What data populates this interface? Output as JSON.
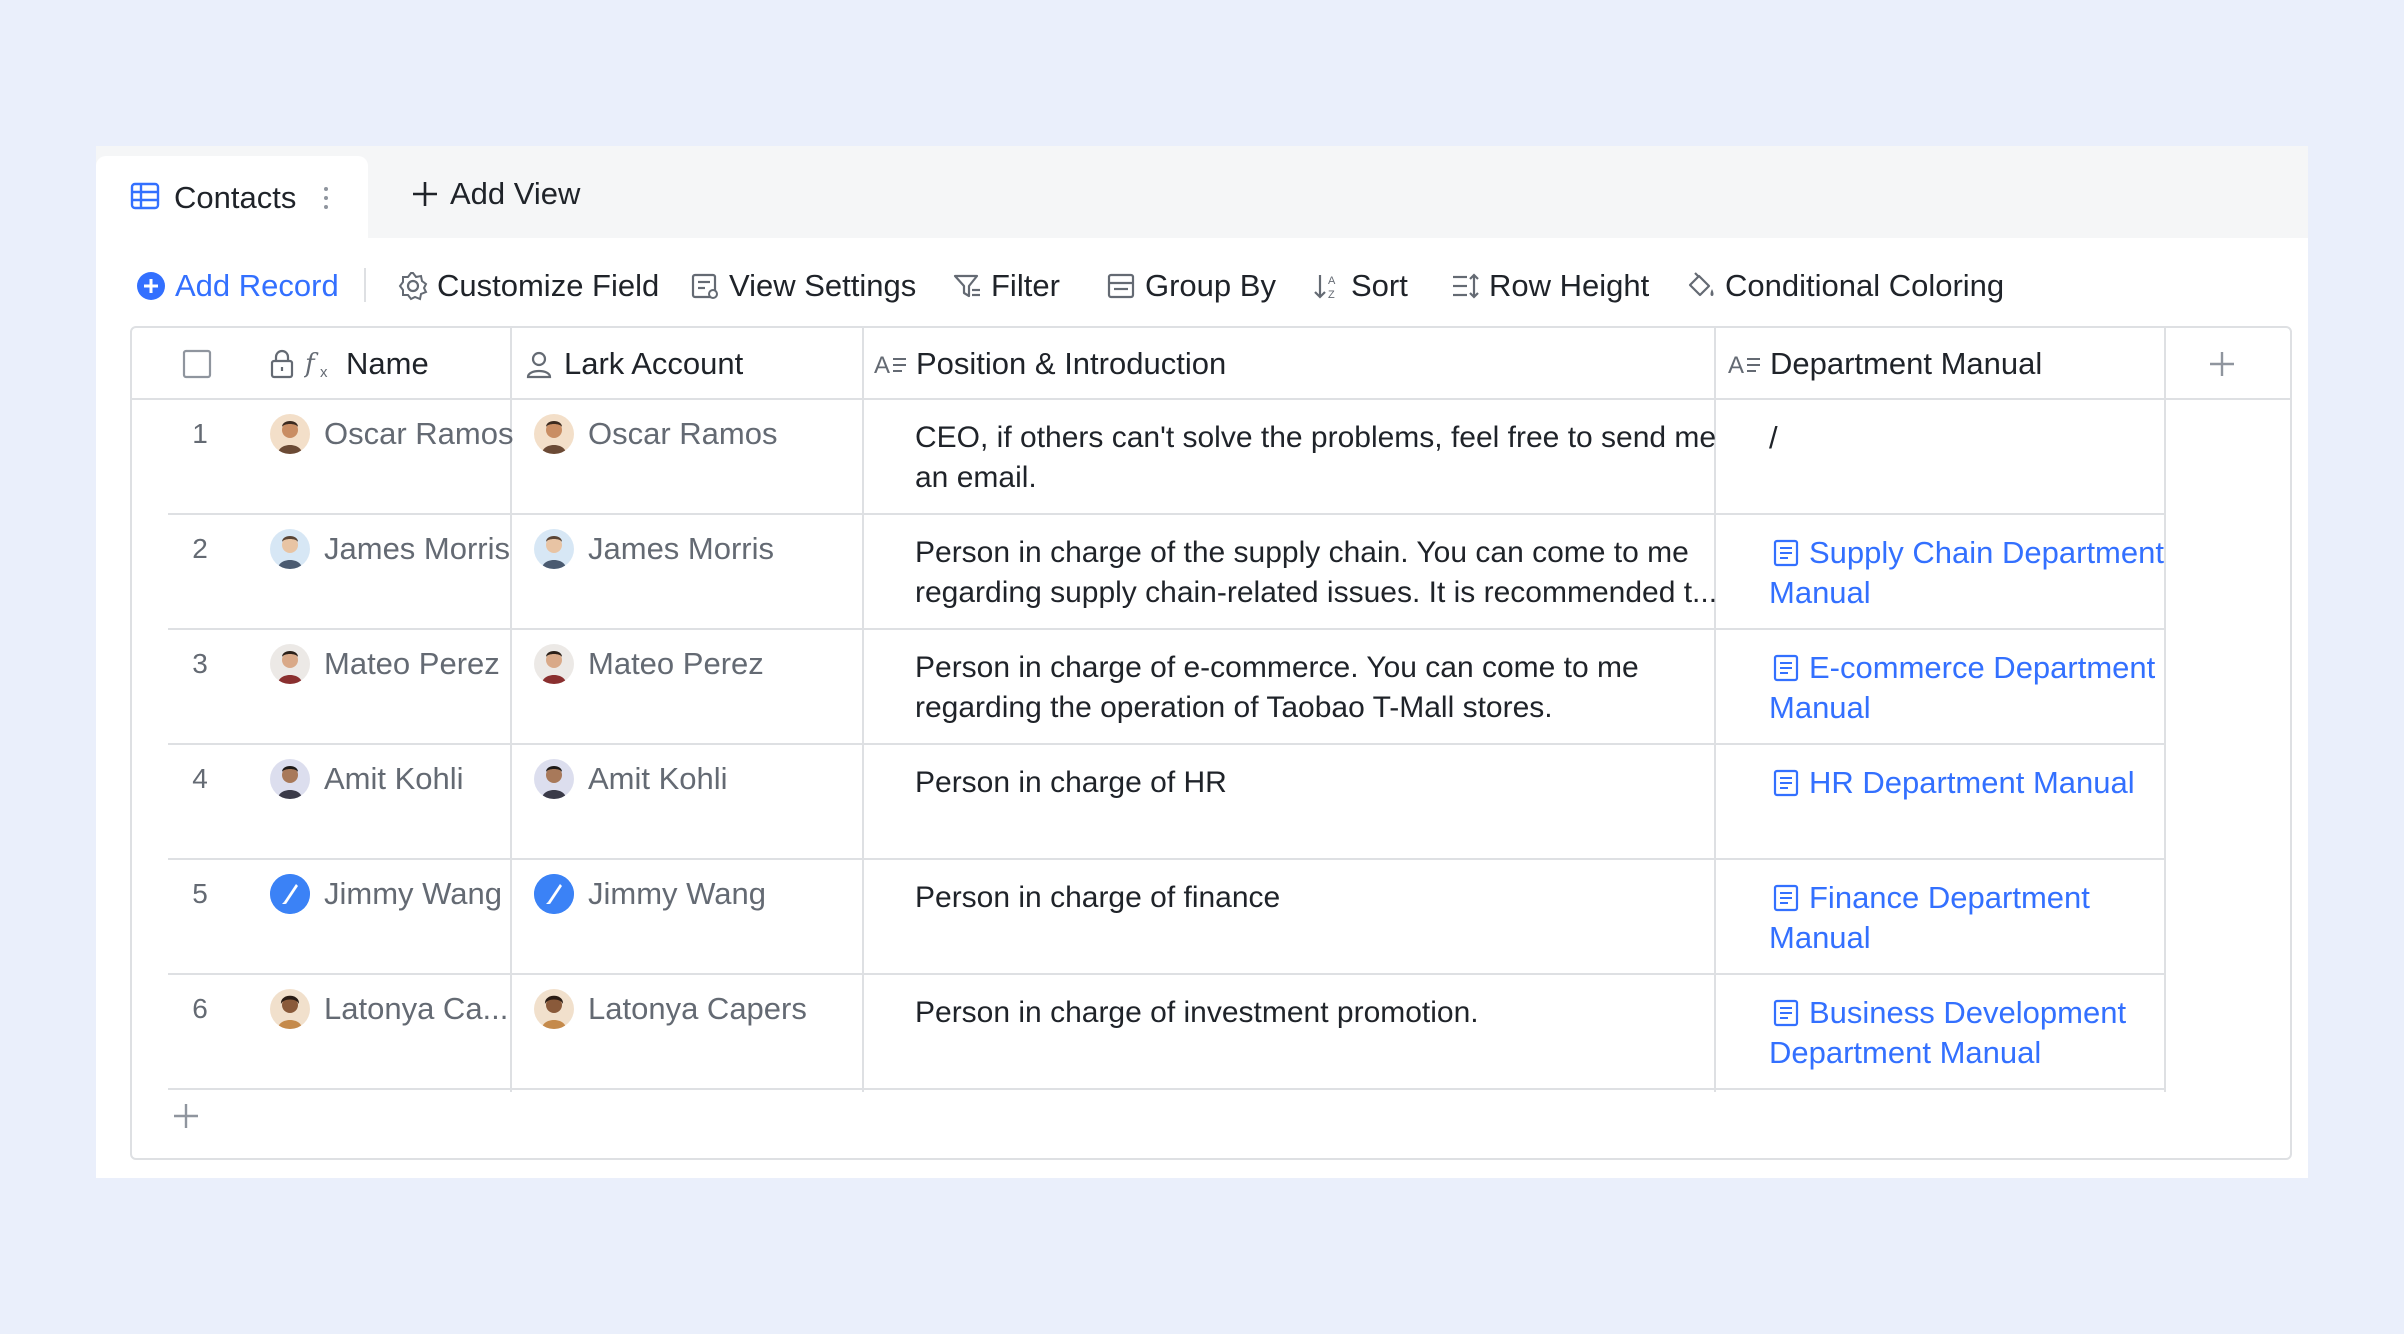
{
  "tabs": {
    "active_label": "Contacts",
    "add_view_label": "Add View"
  },
  "toolbar": {
    "add_record": "Add Record",
    "customize_field": "Customize Field",
    "view_settings": "View Settings",
    "filter": "Filter",
    "group_by": "Group By",
    "sort": "Sort",
    "row_height": "Row Height",
    "conditional_coloring": "Conditional Coloring"
  },
  "columns": {
    "name": "Name",
    "lark_account": "Lark Account",
    "position": "Position & Introduction",
    "manual": "Department Manual"
  },
  "rows": [
    {
      "num": "1",
      "name": "Oscar Ramos",
      "account": "Oscar Ramos",
      "desc": "CEO, if others can't solve the problems, feel free to send me an email.",
      "manual": "/",
      "avatar_color": "#c98d63"
    },
    {
      "num": "2",
      "name": "James Morris",
      "account": "James Morris",
      "desc": "Person in charge of the supply chain. You can come to me regarding supply chain-related issues. It is recommended t...",
      "manual": "Supply Chain Department Manual",
      "avatar_color": "#8fb6d9"
    },
    {
      "num": "3",
      "name": "Mateo Perez",
      "account": "Mateo Perez",
      "desc": "Person in charge of e-commerce. You can come to me regarding the operation of Taobao T-Mall stores.",
      "manual": "E-commerce Department Manual",
      "avatar_color": "#b9b2ad"
    },
    {
      "num": "4",
      "name": "Amit Kohli",
      "account": "Amit Kohli",
      "desc": "Person in charge of HR",
      "manual": "HR Department Manual",
      "avatar_color": "#a3a7c9"
    },
    {
      "num": "5",
      "name": "Jimmy Wang",
      "account": "Jimmy Wang",
      "desc": "Person in charge of finance",
      "manual": "Finance Department Manual",
      "avatar_color": "#3b82f6"
    },
    {
      "num": "6",
      "name": "Latonya Ca...",
      "account": "Latonya Capers",
      "desc": "Person in charge of investment promotion.",
      "manual": "Business Development Department Manual",
      "avatar_color": "#c58a4b"
    }
  ],
  "colors": {
    "accent": "#3370ff",
    "background": "#eaeffb",
    "border": "#dee0e3"
  }
}
